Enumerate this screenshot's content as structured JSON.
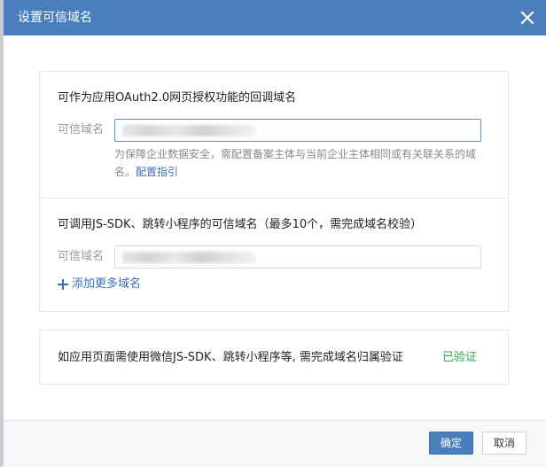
{
  "dialog": {
    "title": "设置可信域名",
    "close_icon": "close-icon"
  },
  "oauth_section": {
    "title": "可作为应用OAuth2.0网页授权功能的回调域名",
    "field_label": "可信域名",
    "field_value": "",
    "hint_text": "为保障企业数据安全，需配置备案主体与当前企业主体相同或有关联关系的域名。",
    "hint_link": "配置指引"
  },
  "jssdk_section": {
    "title": "可调用JS-SDK、跳转小程序的可信域名（最多10个，需完成域名校验）",
    "field_label": "可信域名",
    "field_value": "",
    "add_more": "添加更多域名",
    "add_icon": "plus-icon"
  },
  "verify_section": {
    "text": "如应用页面需使用微信JS-SDK、跳转小程序等, 需完成域名归属验证",
    "status": "已验证",
    "status_color": "#2fa84f"
  },
  "footer": {
    "confirm_label": "确定",
    "cancel_label": "取消"
  },
  "colors": {
    "header": "#4a7fbd",
    "link": "#3b6fb6"
  }
}
